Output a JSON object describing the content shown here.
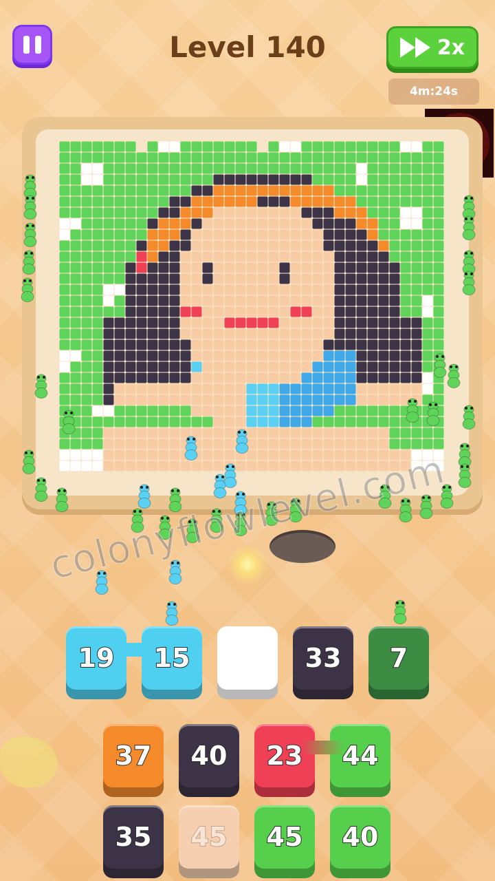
{
  "header": {
    "level_title": "Level 140",
    "speed_label": "2x",
    "timer": "4m:24s"
  },
  "watermark": "colonyflowlevel.com",
  "slots": [
    {
      "value": "19",
      "color": "#4fd0f0",
      "linked": true
    },
    {
      "value": "15",
      "color": "#4fd0f0",
      "linked": true
    },
    {
      "value": "",
      "color": "#ffffff",
      "linked": false
    },
    {
      "value": "33",
      "color": "#3d3346",
      "linked": false
    },
    {
      "value": "7",
      "color": "#3c8c44",
      "linked": false
    }
  ],
  "queue_rows": [
    [
      {
        "value": "37",
        "color": "#f58a2a"
      },
      {
        "value": "40",
        "color": "#3d3346"
      },
      {
        "value": "23",
        "color": "#ef4055"
      },
      {
        "value": "44",
        "color": "#56d04c"
      }
    ],
    [
      {
        "value": "35",
        "color": "#3d3346"
      },
      {
        "value": "45",
        "color": "#f5cfb0"
      },
      {
        "value": "45",
        "color": "#56d04c"
      },
      {
        "value": "40",
        "color": "#56d04c"
      }
    ]
  ],
  "colors": {
    "green": "#5fd35a",
    "white": "#ffffff",
    "dark": "#3d3346",
    "orange": "#f58a2a",
    "skin": "#f8cca5",
    "red": "#ef4055",
    "blue": "#3fa8e8",
    "cyan": "#5ad0f2",
    "pink": "#f2c2b0"
  }
}
